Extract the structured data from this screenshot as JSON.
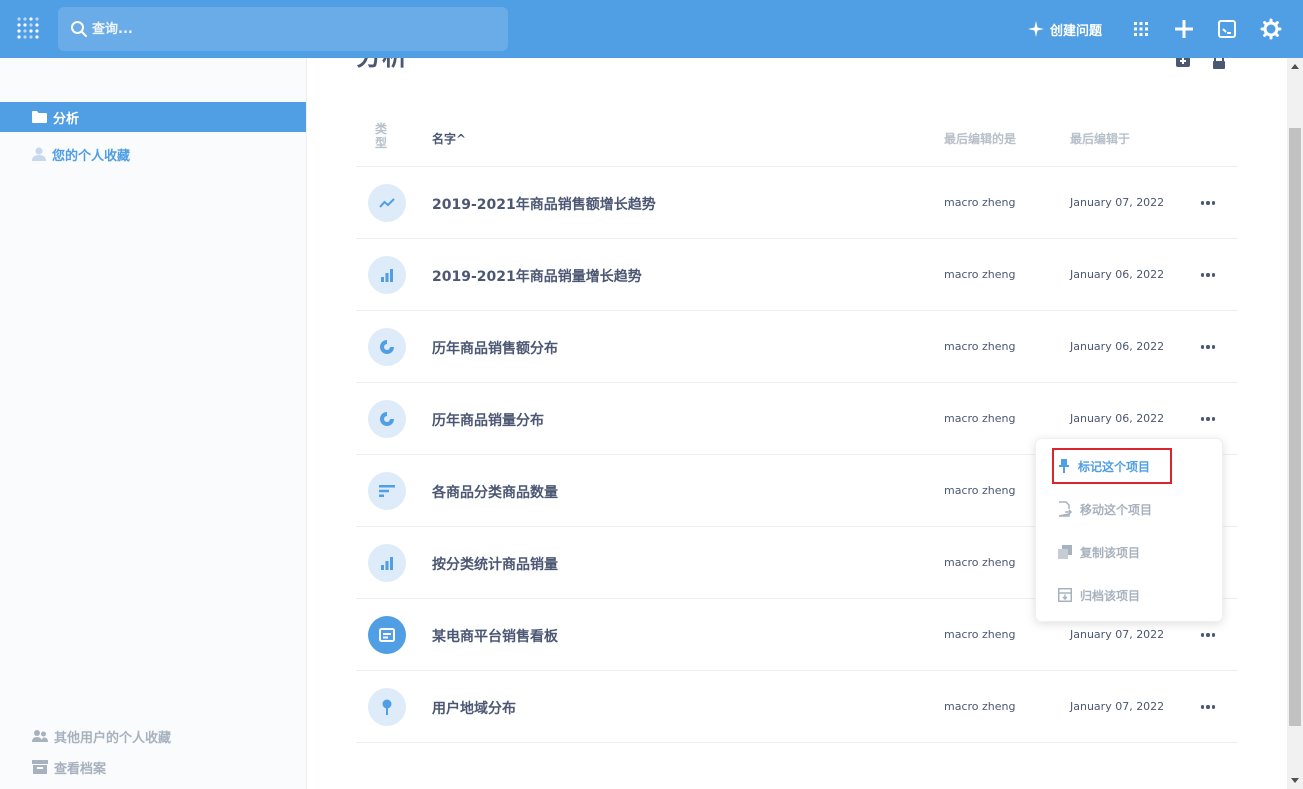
{
  "topbar": {
    "search_placeholder": "查询...",
    "new_question_label": "创建问题"
  },
  "sidebar": {
    "items": [
      {
        "label": "分析"
      },
      {
        "label": "您的个人收藏"
      }
    ],
    "bottom": [
      {
        "label": "其他用户的个人收藏"
      },
      {
        "label": "查看档案"
      }
    ]
  },
  "main": {
    "title": "分析",
    "columns": {
      "type": "类型",
      "name": "名字",
      "sort_arrow": "^",
      "last_editor": "最后编辑的是",
      "last_edited": "最后编辑于"
    },
    "rows": [
      {
        "name": "2019-2021年商品销售额增长趋势",
        "editor": "macro zheng",
        "date": "January 07, 2022",
        "icon": "line-chart-icon"
      },
      {
        "name": "2019-2021年商品销量增长趋势",
        "editor": "macro zheng",
        "date": "January 06, 2022",
        "icon": "bar-chart-icon"
      },
      {
        "name": "历年商品销售额分布",
        "editor": "macro zheng",
        "date": "January 06, 2022",
        "icon": "pie-chart-icon"
      },
      {
        "name": "历年商品销量分布",
        "editor": "macro zheng",
        "date": "January 06, 2022",
        "icon": "pie-chart-icon"
      },
      {
        "name": "各商品分类商品数量",
        "editor": "macro zheng",
        "date": "",
        "icon": "row-chart-icon"
      },
      {
        "name": "按分类统计商品销量",
        "editor": "macro zheng",
        "date": "",
        "icon": "bar-chart-icon"
      },
      {
        "name": "某电商平台销售看板",
        "editor": "macro zheng",
        "date": "January 07, 2022",
        "icon": "dashboard-icon"
      },
      {
        "name": "用户地域分布",
        "editor": "macro zheng",
        "date": "January 07, 2022",
        "icon": "map-pin-icon"
      }
    ]
  },
  "context_menu": {
    "items": [
      {
        "label": "标记这个项目",
        "icon": "pin-icon"
      },
      {
        "label": "移动这个项目",
        "icon": "move-icon"
      },
      {
        "label": "复制该项目",
        "icon": "duplicate-icon"
      },
      {
        "label": "归档该项目",
        "icon": "archive-icon"
      }
    ]
  },
  "colors": {
    "brand": "#509ee3",
    "text": "#4c5773",
    "muted": "#a8b2bf",
    "highlight_border": "#d9262c"
  }
}
